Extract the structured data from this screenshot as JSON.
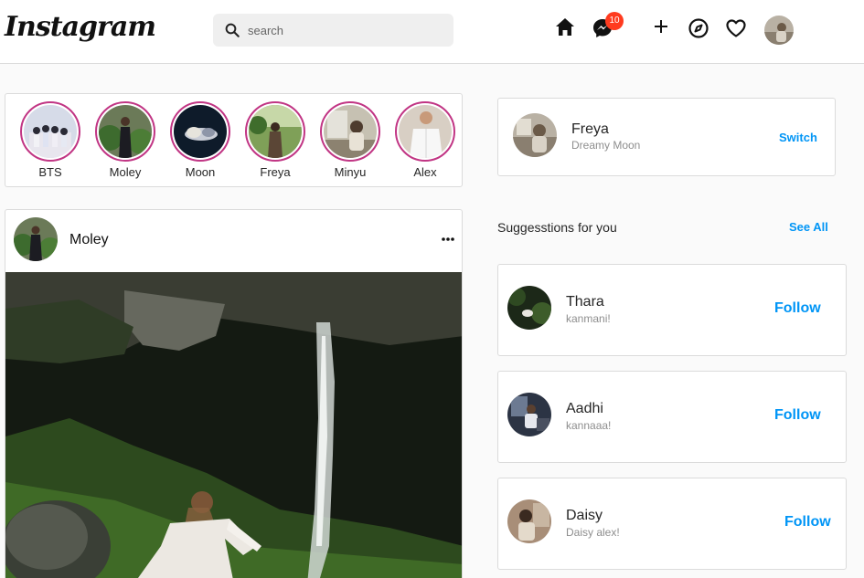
{
  "header": {
    "logo_text": "Instagram",
    "search_placeholder": "search",
    "messages_badge": "10",
    "icons": [
      "home-icon",
      "messenger-icon",
      "plus-icon",
      "compass-icon",
      "heart-icon"
    ]
  },
  "stories": [
    {
      "name": "BTS"
    },
    {
      "name": "Moley"
    },
    {
      "name": "Moon"
    },
    {
      "name": "Freya"
    },
    {
      "name": "Minyu"
    },
    {
      "name": "Alex"
    }
  ],
  "post": {
    "username": "Moley",
    "more_icon": "more-icon"
  },
  "profile": {
    "username": "Freya",
    "full_name": "Dreamy Moon",
    "switch_label": "Switch"
  },
  "suggestions": {
    "title": "Suggesstions for you",
    "see_all_label": "See All",
    "items": [
      {
        "name": "Thara",
        "sub": "kanmani!",
        "follow_label": "Follow"
      },
      {
        "name": "Aadhi",
        "sub": "kannaaa!",
        "follow_label": "Follow"
      },
      {
        "name": "Daisy",
        "sub": "Daisy alex!",
        "follow_label": "Follow"
      }
    ]
  },
  "colors": {
    "accent": "#0095f6",
    "story_ring": "#c13584",
    "badge": "#ff3b1f"
  }
}
